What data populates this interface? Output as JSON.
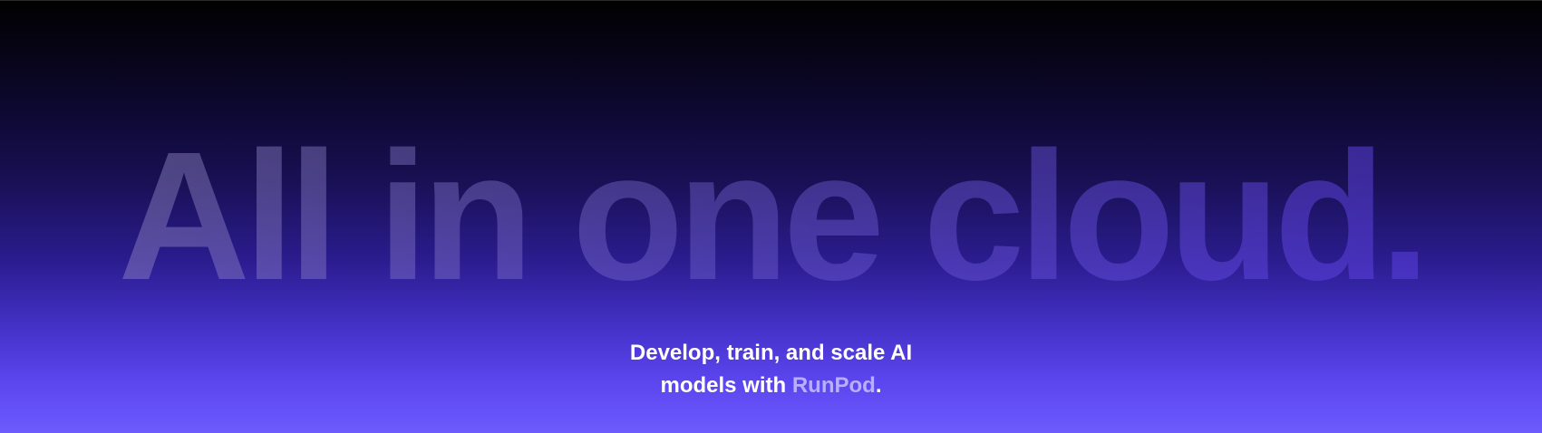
{
  "hero": {
    "headline": "All in one cloud.",
    "tagline_line1": "Develop, train, and scale AI",
    "tagline_line2_prefix": "models with ",
    "brand_name": "RunPod",
    "tagline_suffix": "."
  },
  "colors": {
    "background_top": "#000000",
    "background_bottom": "#6d5bfd",
    "tagline_text": "#ffffff",
    "brand_text": "#b9afff"
  }
}
